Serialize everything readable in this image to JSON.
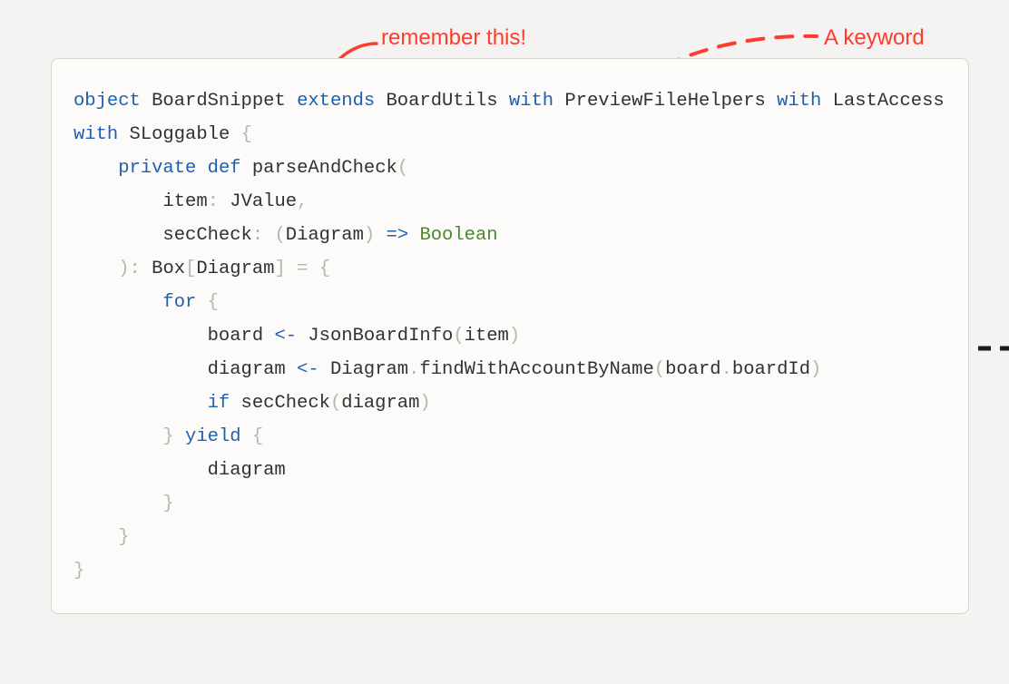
{
  "annotations": {
    "remember": "remember this!",
    "keyword": "A keyword"
  },
  "colors": {
    "annotation": "#ff3b2f",
    "keyword": "#1d5fb0",
    "type": "#4a8a2a",
    "punctuation": "#b8b5af",
    "identifier": "#313131",
    "background": "#f5f3f1",
    "card_bg": "#fcfbf9",
    "card_border": "#d8d4cf"
  },
  "code": {
    "tokens": [
      {
        "t": "object",
        "c": "kw"
      },
      {
        "t": " ",
        "c": ""
      },
      {
        "t": "BoardSnippet",
        "c": "ident"
      },
      {
        "t": " ",
        "c": ""
      },
      {
        "t": "extends",
        "c": "kw"
      },
      {
        "t": " ",
        "c": ""
      },
      {
        "t": "BoardUtils",
        "c": "ident"
      },
      {
        "t": " ",
        "c": ""
      },
      {
        "t": "with",
        "c": "kw"
      },
      {
        "t": " ",
        "c": ""
      },
      {
        "t": "PreviewFileHelpers",
        "c": "ident"
      },
      {
        "t": " ",
        "c": ""
      },
      {
        "t": "with",
        "c": "kw"
      },
      {
        "t": " ",
        "c": ""
      },
      {
        "t": "LastAccess",
        "c": "ident"
      },
      {
        "t": " ",
        "c": ""
      },
      {
        "t": "with",
        "c": "kw"
      },
      {
        "t": " ",
        "c": ""
      },
      {
        "t": "SLoggable",
        "c": "ident"
      },
      {
        "t": " ",
        "c": ""
      },
      {
        "t": "{",
        "c": "punc"
      },
      {
        "t": "\n    ",
        "c": ""
      },
      {
        "t": "private",
        "c": "kw"
      },
      {
        "t": " ",
        "c": ""
      },
      {
        "t": "def",
        "c": "def"
      },
      {
        "t": " ",
        "c": ""
      },
      {
        "t": "parseAndCheck",
        "c": "ident"
      },
      {
        "t": "(",
        "c": "punc"
      },
      {
        "t": "\n        ",
        "c": ""
      },
      {
        "t": "item",
        "c": "ident"
      },
      {
        "t": ":",
        "c": "punc"
      },
      {
        "t": " ",
        "c": ""
      },
      {
        "t": "JValue",
        "c": "ident"
      },
      {
        "t": ",",
        "c": "punc"
      },
      {
        "t": "\n        ",
        "c": ""
      },
      {
        "t": "secCheck",
        "c": "ident"
      },
      {
        "t": ":",
        "c": "punc"
      },
      {
        "t": " ",
        "c": ""
      },
      {
        "t": "(",
        "c": "punc"
      },
      {
        "t": "Diagram",
        "c": "ident"
      },
      {
        "t": ")",
        "c": "punc"
      },
      {
        "t": " ",
        "c": ""
      },
      {
        "t": "=>",
        "c": "arrow"
      },
      {
        "t": " ",
        "c": ""
      },
      {
        "t": "Boolean",
        "c": "type"
      },
      {
        "t": "\n    ",
        "c": ""
      },
      {
        "t": ")",
        "c": "punc"
      },
      {
        "t": ":",
        "c": "punc"
      },
      {
        "t": " ",
        "c": ""
      },
      {
        "t": "Box",
        "c": "ident"
      },
      {
        "t": "[",
        "c": "punc"
      },
      {
        "t": "Diagram",
        "c": "ident"
      },
      {
        "t": "]",
        "c": "punc"
      },
      {
        "t": " ",
        "c": ""
      },
      {
        "t": "=",
        "c": "punc"
      },
      {
        "t": " ",
        "c": ""
      },
      {
        "t": "{",
        "c": "punc"
      },
      {
        "t": "\n        ",
        "c": ""
      },
      {
        "t": "for",
        "c": "kw"
      },
      {
        "t": " ",
        "c": ""
      },
      {
        "t": "{",
        "c": "punc"
      },
      {
        "t": "\n            ",
        "c": ""
      },
      {
        "t": "board",
        "c": "ident"
      },
      {
        "t": " ",
        "c": ""
      },
      {
        "t": "<-",
        "c": "arrow"
      },
      {
        "t": " ",
        "c": ""
      },
      {
        "t": "JsonBoardInfo",
        "c": "ident"
      },
      {
        "t": "(",
        "c": "punc"
      },
      {
        "t": "item",
        "c": "ident"
      },
      {
        "t": ")",
        "c": "punc"
      },
      {
        "t": "\n            ",
        "c": ""
      },
      {
        "t": "diagram",
        "c": "ident"
      },
      {
        "t": " ",
        "c": ""
      },
      {
        "t": "<-",
        "c": "arrow"
      },
      {
        "t": " ",
        "c": ""
      },
      {
        "t": "Diagram",
        "c": "ident"
      },
      {
        "t": ".",
        "c": "punc"
      },
      {
        "t": "findWithAccountByName",
        "c": "ident"
      },
      {
        "t": "(",
        "c": "punc"
      },
      {
        "t": "board",
        "c": "ident"
      },
      {
        "t": ".",
        "c": "punc"
      },
      {
        "t": "boardId",
        "c": "ident"
      },
      {
        "t": ")",
        "c": "punc"
      },
      {
        "t": "\n            ",
        "c": ""
      },
      {
        "t": "if",
        "c": "kw"
      },
      {
        "t": " ",
        "c": ""
      },
      {
        "t": "secCheck",
        "c": "ident"
      },
      {
        "t": "(",
        "c": "punc"
      },
      {
        "t": "diagram",
        "c": "ident"
      },
      {
        "t": ")",
        "c": "punc"
      },
      {
        "t": "\n        ",
        "c": ""
      },
      {
        "t": "}",
        "c": "punc"
      },
      {
        "t": " ",
        "c": ""
      },
      {
        "t": "yield",
        "c": "kw"
      },
      {
        "t": " ",
        "c": ""
      },
      {
        "t": "{",
        "c": "punc"
      },
      {
        "t": "\n            ",
        "c": ""
      },
      {
        "t": "diagram",
        "c": "ident"
      },
      {
        "t": "\n        ",
        "c": ""
      },
      {
        "t": "}",
        "c": "punc"
      },
      {
        "t": "\n    ",
        "c": ""
      },
      {
        "t": "}",
        "c": "punc"
      },
      {
        "t": "\n",
        "c": ""
      },
      {
        "t": "}",
        "c": "punc"
      }
    ]
  }
}
